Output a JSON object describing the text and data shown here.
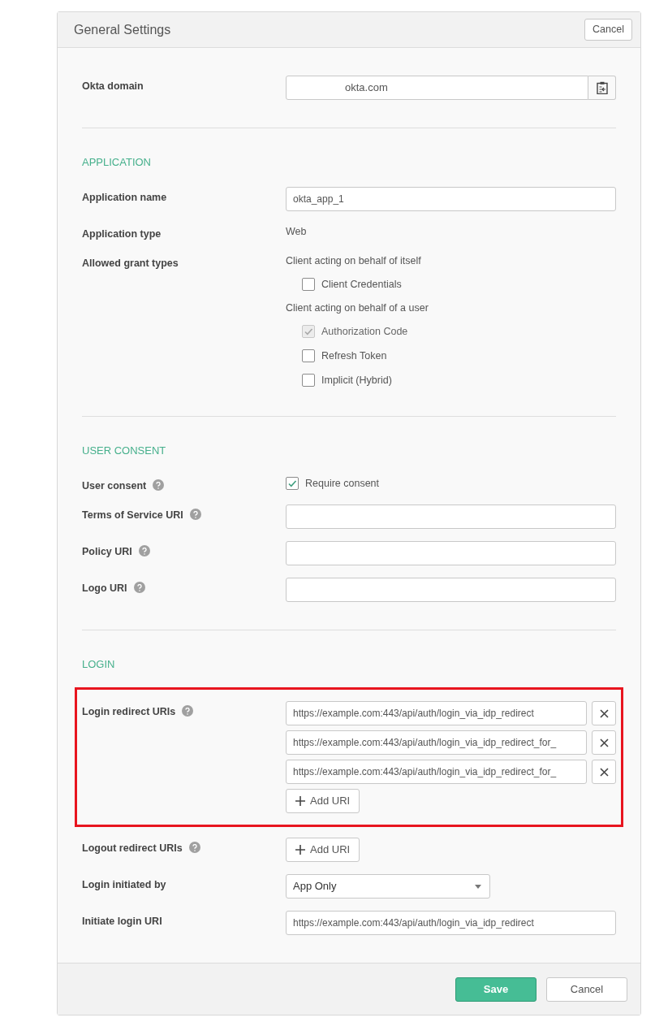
{
  "header": {
    "title": "General Settings",
    "cancel": "Cancel"
  },
  "sections": [
    {
      "rows": [
        {
          "kind": "domain",
          "label": "Okta domain",
          "value": "okta.com"
        }
      ]
    },
    {
      "heading": "APPLICATION",
      "rows": [
        {
          "kind": "field",
          "label": "Application name",
          "value": "okta_app_1"
        },
        {
          "kind": "static",
          "label": "Application type",
          "value": "Web"
        },
        {
          "kind": "grants",
          "label": "Allowed grant types",
          "groups": [
            {
              "title": "Client acting on behalf of itself",
              "options": [
                {
                  "label": "Client Credentials",
                  "checked": false,
                  "disabled": false
                }
              ]
            },
            {
              "title": "Client acting on behalf of a user",
              "options": [
                {
                  "label": "Authorization Code",
                  "checked": true,
                  "disabled": true
                },
                {
                  "label": "Refresh Token",
                  "checked": false,
                  "disabled": false
                },
                {
                  "label": "Implicit (Hybrid)",
                  "checked": false,
                  "disabled": false
                }
              ]
            }
          ]
        }
      ]
    },
    {
      "heading": "USER CONSENT",
      "rows": [
        {
          "kind": "checkbox",
          "label": "User consent",
          "help": true,
          "option": {
            "label": "Require consent",
            "checked": true,
            "disabled": false
          }
        },
        {
          "kind": "field",
          "label": "Terms of Service URI",
          "help": true,
          "value": ""
        },
        {
          "kind": "field",
          "label": "Policy URI",
          "help": true,
          "value": ""
        },
        {
          "kind": "field",
          "label": "Logo URI",
          "help": true,
          "value": ""
        }
      ]
    },
    {
      "heading": "LOGIN",
      "rows": [
        {
          "kind": "uris",
          "label": "Login redirect URIs",
          "help": true,
          "highlighted": true,
          "uris": [
            "https://example.com:443/api/auth/login_via_idp_redirect",
            "https://example.com:443/api/auth/login_via_idp_redirect_for_",
            "https://example.com:443/api/auth/login_via_idp_redirect_for_"
          ],
          "add": "Add URI"
        },
        {
          "kind": "uris",
          "label": "Logout redirect URIs",
          "help": true,
          "highlighted": false,
          "uris": [],
          "add": "Add URI"
        },
        {
          "kind": "select",
          "label": "Login initiated by",
          "value": "App Only"
        },
        {
          "kind": "field",
          "label": "Initiate login URI",
          "value": "https://example.com:443/api/auth/login_via_idp_redirect"
        }
      ]
    }
  ],
  "footer": {
    "save": "Save",
    "cancel": "Cancel"
  }
}
